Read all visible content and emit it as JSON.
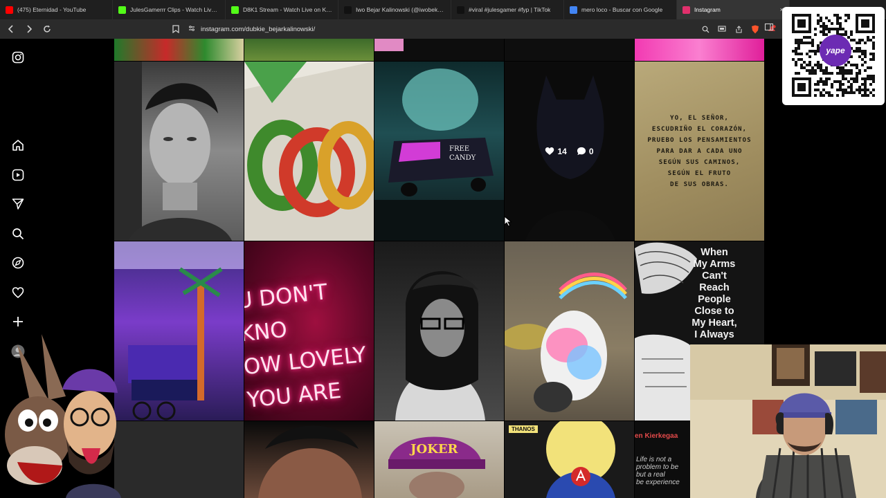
{
  "browser": {
    "tabs": [
      {
        "label": "(475) Eternidad - YouTube",
        "icon": "youtube-icon",
        "color": "#ff0000",
        "active": false
      },
      {
        "label": "JulesGamerrr Clips - Watch Live on Kick",
        "icon": "kick-icon",
        "color": "#53fc18",
        "active": false
      },
      {
        "label": "D8K1 Stream - Watch Live on Kick",
        "icon": "kick-icon",
        "color": "#53fc18",
        "active": false
      },
      {
        "label": "Iwo Bejar Kalinowski (@iwobeka) | TikTok",
        "icon": "tiktok-icon",
        "color": "#111111",
        "active": false
      },
      {
        "label": "#viral #julesgamer #fyp | TikTok",
        "icon": "tiktok-icon",
        "color": "#111111",
        "active": false
      },
      {
        "label": "mero loco - Buscar con Google",
        "icon": "google-icon",
        "color": "#4285f4",
        "active": false
      },
      {
        "label": "Instagram",
        "icon": "instagram-icon",
        "color": "#e1306c",
        "active": true
      }
    ],
    "url": "instagram.com/dubkie_bejarkalinowski/"
  },
  "sidebar": {
    "items": [
      "instagram-logo-icon",
      "home-icon",
      "reels-icon",
      "send-icon",
      "search-icon",
      "explore-icon",
      "heart-icon",
      "plus-icon",
      "profile-avatar"
    ]
  },
  "posts": {
    "hover_likes": "14",
    "hover_comments": "0",
    "quote": "YO, EL SEÑOR,\nESCUDRIÑO EL CORAZÓN,\nPRUEBO LOS PENSAMIENTOS\nPARA DAR A CADA UNO\nSEGÚN SUS CAMINOS,\nSEGÚN EL FRUTO\nDE SUS OBRAS.",
    "neon": "U DON'T KNO\nOW LOVELY\nYOU ARE",
    "van_text": "FREE\nCANDY",
    "arms": "When\nMy Arms\nCan't\nReach\nPeople\nClose to\nMy Heart,\nI Always",
    "kierkegaard_name": "en Kierkegaa",
    "kierkegaard_quote": "Life is not a\nproblem to be\nbut a real\nbe experience",
    "joker": "JOKER",
    "thanos": "THANOS"
  },
  "overlay": {
    "qr_brand": "yape"
  }
}
